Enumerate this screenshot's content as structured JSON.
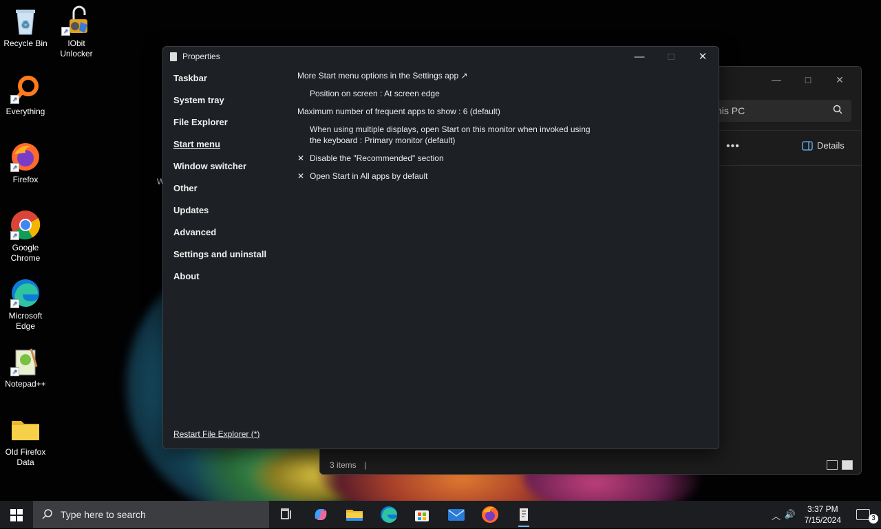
{
  "desktop": {
    "icons": [
      {
        "label": "Recycle Bin",
        "icon": "recycle-bin-icon"
      },
      {
        "label": "IObit Unlocker",
        "icon": "iobit-unlocker-icon"
      },
      {
        "label": "Everything",
        "icon": "everything-search-icon"
      },
      {
        "label": "Firefox",
        "icon": "firefox-icon"
      },
      {
        "label": "Google Chrome",
        "icon": "chrome-icon"
      },
      {
        "label": "Microsoft Edge",
        "icon": "edge-icon"
      },
      {
        "label": "Notepad++",
        "icon": "notepadpp-icon"
      },
      {
        "label": "Old Firefox Data",
        "icon": "folder-icon"
      }
    ],
    "partial_label": "W"
  },
  "explorer": {
    "search_text": "his PC",
    "more_label": "•••",
    "details_label": "Details",
    "status_text": "3 items",
    "status_sep": "|"
  },
  "properties": {
    "title": "Properties",
    "controls": {
      "minimize": "—",
      "maximize": "□",
      "close": "✕"
    },
    "nav": [
      "Taskbar",
      "System tray",
      "File Explorer",
      "Start menu",
      "Window switcher",
      "Other",
      "Updates",
      "Advanced",
      "Settings and uninstall",
      "About"
    ],
    "active_nav": "Start menu",
    "content": {
      "settings_link": "More Start menu options in the Settings app ↗",
      "position": "Position on screen : At screen edge",
      "max_frequent": "Maximum number of frequent apps to show : 6 (default)",
      "multi_display_line1": "When using multiple displays, open Start on this monitor when invoked using",
      "multi_display_line2": "the keyboard : Primary monitor (default)",
      "disable_recommended": "Disable the \"Recommended\" section",
      "open_all_apps": "Open Start in All apps by default",
      "check_mark": "✕"
    },
    "restart_link": "Restart File Explorer (*)"
  },
  "taskbar": {
    "search_placeholder": "Type here to search",
    "clock_time": "3:37 PM",
    "clock_date": "7/15/2024",
    "notification_count": "3",
    "tray_chevron": "︿",
    "volume_glyph": "🔊",
    "apps": [
      "task-view-icon",
      "copilot-icon",
      "file-explorer-icon",
      "edge-icon",
      "store-icon",
      "mail-icon",
      "firefox-icon",
      "properties-app-icon"
    ]
  },
  "colors": {
    "window_bg": "#1d2025",
    "taskbar_bg": "#1b1d20",
    "accent": "#6cb8ff"
  }
}
